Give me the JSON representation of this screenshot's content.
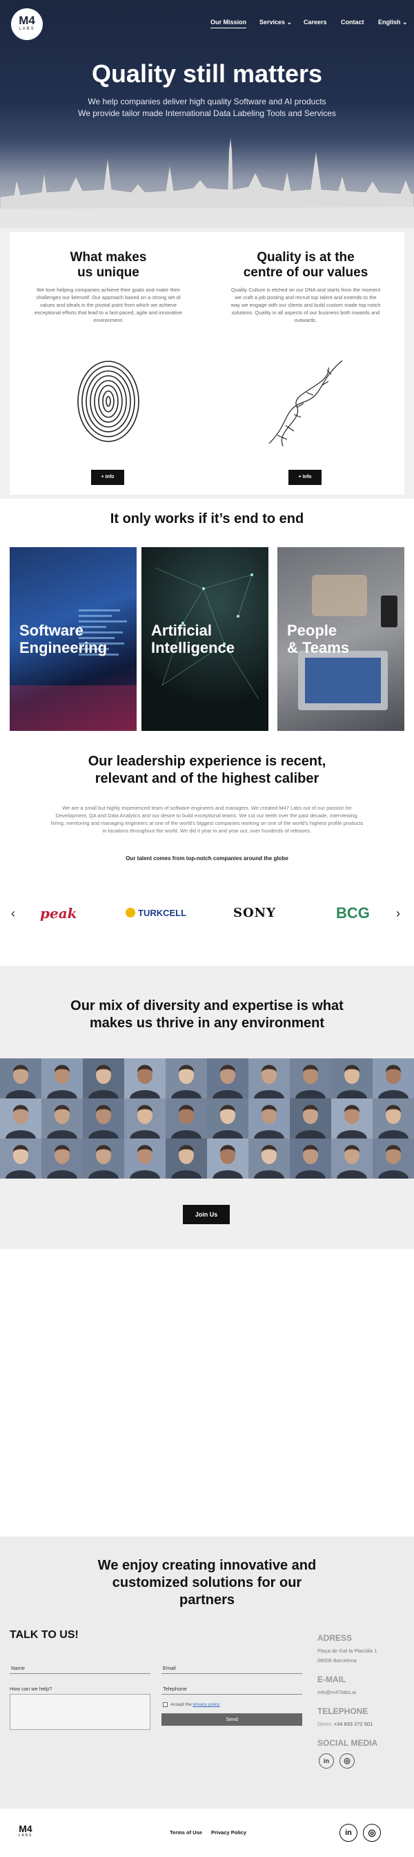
{
  "brand": {
    "logo_main": "M4",
    "logo_sub": "LABS"
  },
  "nav": {
    "items": [
      "Our Mission",
      "Services",
      "Careers",
      "Contact",
      "English"
    ]
  },
  "hero": {
    "title": "Quality still matters",
    "line1": "We help companies deliver high quality Software and AI products",
    "line2": "We provide tailor made International Data Labeling Tools and Services"
  },
  "values": [
    {
      "title_l1": "What makes",
      "title_l2": "us unique",
      "text": "We love helping companies achieve their goals and make their challenges our lietmotif. Our approach based on a strong set of values and ideals is the pivotal point from which we achieve exceptional efforts that lead to a fast-paced, agile and innovative environment.",
      "button": "+ Info"
    },
    {
      "title_l1": "Quality is at the",
      "title_l2": "centre of our values",
      "text": "Quality Culture is etched on our DNA and starts from the moment we craft a job posting and recruit top talent and extends to the way we engage with our clients and build custom made top-notch solutions. Quality in all aspects of our business both inwards and outwards.",
      "button": "+ Info"
    }
  ],
  "e2e": {
    "title": "It only works if it’s end to end",
    "tiles": [
      {
        "l1": "Software",
        "l2": "Engineering"
      },
      {
        "l1": "Artificial",
        "l2": "Intelligence"
      },
      {
        "l1": "People",
        "l2": "& Teams"
      }
    ]
  },
  "leadership": {
    "title_l1": "Our leadership experience is recent,",
    "title_l2": "relevant and of the highest caliber",
    "text": "We are a small but highly experienced team of software engineers and managers. We created M47 Labs out of our passion for Development, QA and Data Analytics and our desire to build exceptional teams. We cut our teeth over the past decade, interviewing, hiring, mentoring and managing engineers at one of the world's biggest companies working on one of the world's highest profile products in locations throughout the world. We did it year in and year out, over hundreds of releases.",
    "subtitle": "Our talent comes from top-notch companies around the globe",
    "logos": [
      "peak",
      "TURKCELL",
      "SONY",
      "BCG"
    ],
    "prev": "‹",
    "next": "›"
  },
  "diversity": {
    "title_l1": "Our mix of diversity and expertise is what",
    "title_l2": "makes us thrive in any environment",
    "button": "Join Us"
  },
  "contact": {
    "title_l1": "We enjoy creating innovative and",
    "title_l2": "customized solutions for our",
    "title_l3": "partners",
    "talk": "TALK TO US!",
    "name_label": "Name",
    "email_label": "Email",
    "help_label": "How can we help?",
    "phone_label": "Telephone",
    "accept_prefix": "Accept the",
    "privacy_link": "privacy policy",
    "send": "Send",
    "adress_head": "ADRESS",
    "adress_l1": "Plaça de Gal·la Placídia 1",
    "adress_l2": "08006 Barcelona",
    "email_head": "E-MAIL",
    "email_val": "info@m47labs.ai",
    "phone_head": "TELEPHONE",
    "phone_prefix": "Direct:",
    "phone_val": "+34 633 272 501",
    "social_head": "SOCIAL MEDIA",
    "in": "in",
    "ig": "◎"
  },
  "footer": {
    "terms": "Terms of Use",
    "privacy": "Privacy Policy",
    "in": "in",
    "ig": "◎"
  },
  "colors": {
    "navy": "#1c2740",
    "accent": "#5b9bd5"
  }
}
